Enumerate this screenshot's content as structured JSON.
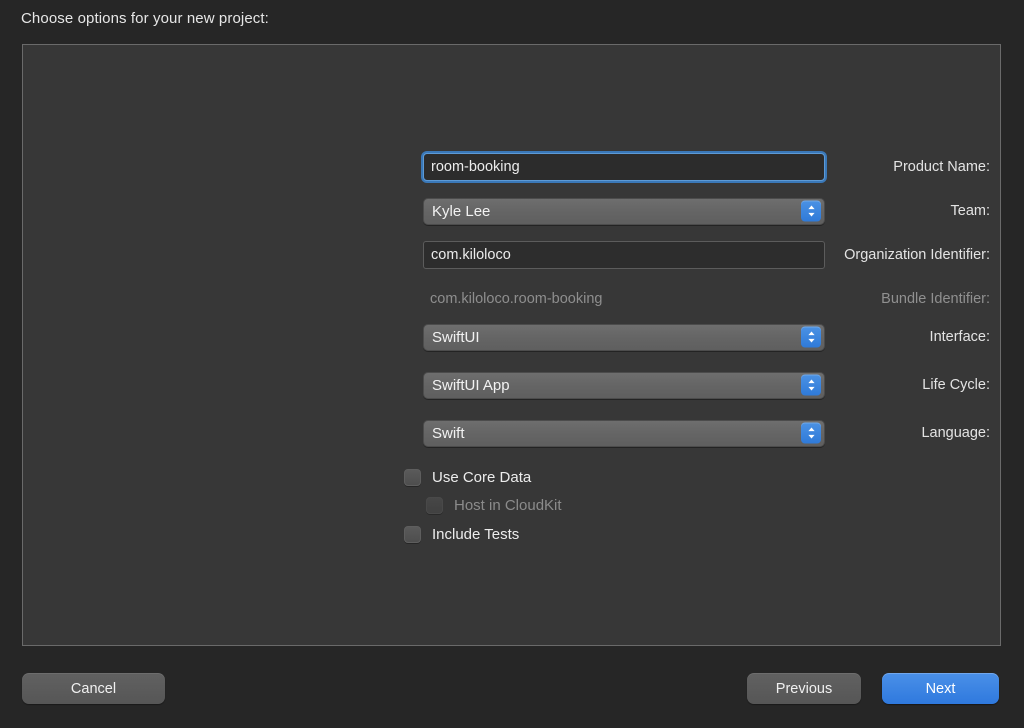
{
  "dialog": {
    "heading": "Choose options for your new project:"
  },
  "form": {
    "fields": [
      {
        "label": "Product Name:",
        "type": "textfield",
        "value": "room-booking",
        "placeholder": "",
        "focused": true,
        "disabled": false
      },
      {
        "label": "Team:",
        "type": "popup",
        "value": "Kyle Lee",
        "disabled": false
      },
      {
        "label": "Organization Identifier:",
        "type": "textfield",
        "value": "com.kiloloco",
        "placeholder": "",
        "focused": false,
        "disabled": false
      },
      {
        "label": "Bundle Identifier:",
        "type": "statictext",
        "value": "com.kiloloco.room-booking",
        "disabled": true
      },
      {
        "label": "Interface:",
        "type": "popup",
        "value": "SwiftUI",
        "disabled": false
      },
      {
        "label": "Life Cycle:",
        "type": "popup",
        "value": "SwiftUI App",
        "disabled": false
      },
      {
        "label": "Language:",
        "type": "popup",
        "value": "Swift",
        "disabled": false
      }
    ],
    "checkboxes": [
      {
        "label": "Use Core Data",
        "checked": false,
        "disabled": false,
        "indented": false
      },
      {
        "label": "Host in CloudKit",
        "checked": false,
        "disabled": true,
        "indented": true
      },
      {
        "label": "Include Tests",
        "checked": false,
        "disabled": false,
        "indented": false
      }
    ]
  },
  "footer": {
    "cancel_label": "Cancel",
    "previous_label": "Previous",
    "next_label": "Next"
  },
  "colors": {
    "page_background": "#262626",
    "panel_background": "#373737",
    "panel_border": "#6a6a6a",
    "accent_blue": "#2f79de",
    "focus_ring": "#3a78b8",
    "popup_fill": "#656565",
    "disabled_text": "#8e8e8e",
    "text": "#e6e6e6"
  },
  "icons": {
    "stepper": "stepper-updown-icon"
  }
}
